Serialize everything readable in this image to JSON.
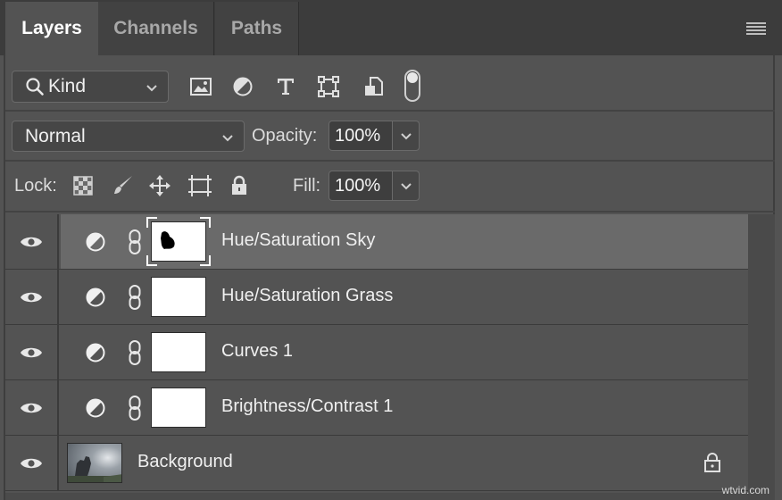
{
  "tabs": [
    {
      "label": "Layers",
      "active": true
    },
    {
      "label": "Channels",
      "active": false
    },
    {
      "label": "Paths",
      "active": false
    }
  ],
  "filter": {
    "kind_label": "Kind",
    "icons": [
      "image-filter-icon",
      "adjustment-filter-icon",
      "type-filter-icon",
      "shape-filter-icon",
      "smart-object-filter-icon"
    ],
    "toggle_on": true
  },
  "blend": {
    "mode": "Normal",
    "opacity_label": "Opacity:",
    "opacity_value": "100%"
  },
  "lock": {
    "label": "Lock:",
    "icons": [
      "lock-transparent-icon",
      "lock-pixels-icon",
      "lock-position-icon",
      "lock-artboard-icon",
      "lock-all-icon"
    ],
    "fill_label": "Fill:",
    "fill_value": "100%"
  },
  "layers": [
    {
      "name": "Hue/Saturation Sky",
      "selected": true,
      "type": "adjustment"
    },
    {
      "name": "Hue/Saturation Grass",
      "selected": false,
      "type": "adjustment"
    },
    {
      "name": "Curves 1",
      "selected": false,
      "type": "adjustment"
    },
    {
      "name": "Brightness/Contrast 1",
      "selected": false,
      "type": "adjustment"
    },
    {
      "name": "Background",
      "selected": false,
      "type": "image",
      "locked": true
    }
  ],
  "colors": {
    "panel_bg": "#535353",
    "selected_row": "#6a6a6a",
    "tab_bar": "#3c3c3c"
  },
  "watermark": "wtvid.com"
}
